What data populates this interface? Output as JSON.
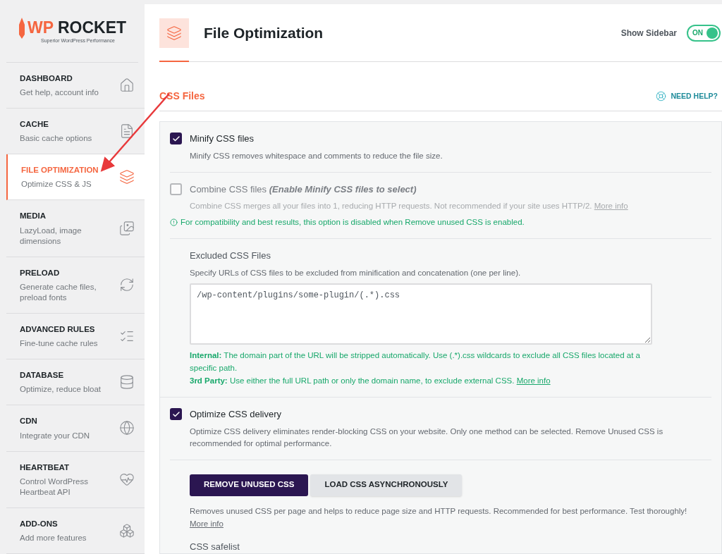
{
  "logo": {
    "first": "WP",
    "second": "ROCKET",
    "tagline": "Superior WordPress Performance"
  },
  "sidebar": {
    "items": [
      {
        "title": "DASHBOARD",
        "subtitle": "Get help, account info",
        "selected": false
      },
      {
        "title": "CACHE",
        "subtitle": "Basic cache options",
        "selected": false
      },
      {
        "title": "FILE OPTIMIZATION",
        "subtitle": "Optimize CSS & JS",
        "selected": true
      },
      {
        "title": "MEDIA",
        "subtitle": "LazyLoad, image dimensions",
        "selected": false
      },
      {
        "title": "PRELOAD",
        "subtitle": "Generate cache files, preload fonts",
        "selected": false
      },
      {
        "title": "ADVANCED RULES",
        "subtitle": "Fine-tune cache rules",
        "selected": false
      },
      {
        "title": "DATABASE",
        "subtitle": "Optimize, reduce bloat",
        "selected": false
      },
      {
        "title": "CDN",
        "subtitle": "Integrate your CDN",
        "selected": false
      },
      {
        "title": "HEARTBEAT",
        "subtitle": "Control WordPress Heartbeat API",
        "selected": false
      },
      {
        "title": "ADD-ONS",
        "subtitle": "Add more features",
        "selected": false
      }
    ]
  },
  "header": {
    "title": "File Optimization",
    "show_sidebar": {
      "label": "Show Sidebar",
      "on": true,
      "state_label": "ON"
    }
  },
  "section": {
    "title": "CSS Files",
    "help": "NEED HELP?"
  },
  "options": [
    {
      "kind": "checkbox",
      "label": "Minify CSS files",
      "checked": true,
      "disabled": false,
      "description": "Minify CSS removes whitespace and comments to reduce the file size."
    },
    {
      "kind": "checkbox",
      "label": "Combine CSS files",
      "label_note": "(Enable Minify CSS files to select)",
      "checked": false,
      "disabled": true,
      "description": "Combine CSS merges all your files into 1, reducing HTTP requests. Not recommended if your site uses HTTP/2.",
      "link": "More info",
      "warning": "For compatibility and best results, this option is disabled when Remove unused CSS is enabled."
    },
    {
      "kind": "textarea",
      "label": "Excluded CSS Files",
      "description": "Specify URLs of CSS files to be excluded from minification and concatenation (one per line).",
      "value": "/wp-content/plugins/some-plugin/(.*).css",
      "notes": [
        {
          "text": "**Internal:** The domain part of the URL will be stripped automatically. Use (.*).css wildcards to exclude all CSS files located at a specific path."
        },
        {
          "text": "**3rd Party:** Use either the full URL path or only the domain name, to exclude external CSS.",
          "link": "More info"
        }
      ]
    },
    {
      "kind": "checkbox",
      "label": "Optimize CSS delivery",
      "checked": true,
      "disabled": false,
      "description": "Optimize CSS delivery eliminates render-blocking CSS on your website. Only one method can be selected. Remove Unused CSS is recommended for optimal performance."
    },
    {
      "kind": "methods",
      "buttons": [
        {
          "label": "REMOVE UNUSED CSS",
          "selected": true
        },
        {
          "label": "LOAD CSS ASYNCHRONOUSLY",
          "selected": false
        }
      ],
      "description": "Removes unused CSS per page and helps to reduce page size and HTTP requests. Recommended for best performance. Test thoroughly!",
      "link": "More info",
      "next_label": "CSS safelist"
    }
  ]
}
